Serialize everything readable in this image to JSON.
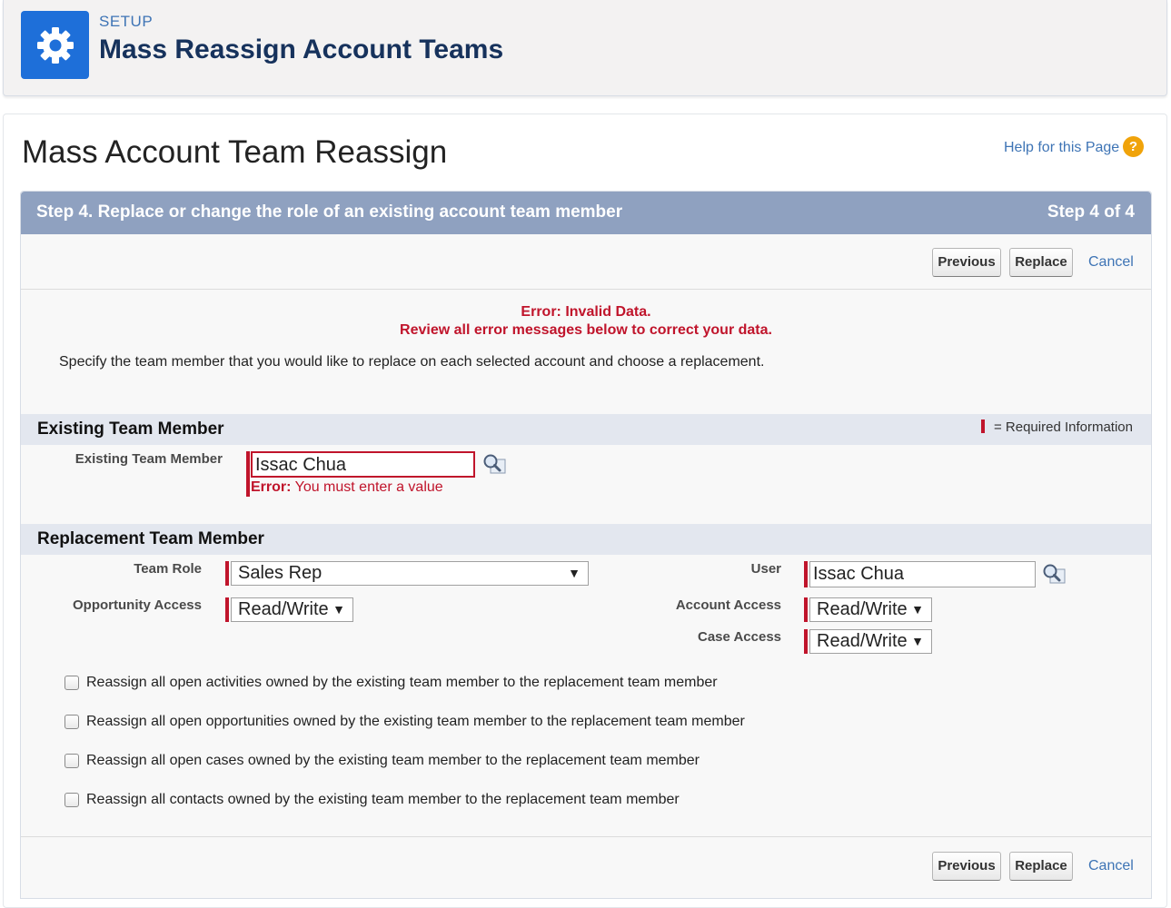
{
  "header": {
    "section_label": "SETUP",
    "title": "Mass Reassign Account Teams"
  },
  "page": {
    "title": "Mass Account Team Reassign",
    "help_link": "Help for this Page",
    "help_icon_glyph": "?"
  },
  "step": {
    "title": "Step 4. Replace or change the role of an existing account team member",
    "count": "Step 4 of 4"
  },
  "buttons": {
    "previous": "Previous",
    "replace": "Replace",
    "cancel": "Cancel"
  },
  "errors": {
    "title": "Error: Invalid Data.",
    "subtitle": "Review all error messages below to correct your data.",
    "field_error_prefix": "Error:",
    "field_error_text": " You must enter a value"
  },
  "instructions": "Specify the team member that you would like to replace on each selected account and choose a replacement.",
  "existing_section": {
    "title": "Existing Team Member",
    "required_legend": "= Required Information",
    "field_label": "Existing Team Member",
    "field_value": "Issac Chua"
  },
  "replacement_section": {
    "title": "Replacement Team Member",
    "team_role_label": "Team Role",
    "team_role_value": "Sales Rep",
    "opportunity_access_label": "Opportunity Access",
    "opportunity_access_value": "Read/Write",
    "user_label": "User",
    "user_value": "Issac Chua",
    "account_access_label": "Account Access",
    "account_access_value": "Read/Write",
    "case_access_label": "Case Access",
    "case_access_value": "Read/Write"
  },
  "checkboxes": [
    {
      "label": "Reassign all open activities owned by the existing team member to the replacement team member",
      "checked": false
    },
    {
      "label": "Reassign all open opportunities owned by the existing team member to the replacement team member",
      "checked": false
    },
    {
      "label": "Reassign all open cases owned by the existing team member to the replacement team member",
      "checked": false
    },
    {
      "label": "Reassign all contacts owned by the existing team member to the replacement team member",
      "checked": false
    }
  ],
  "colors": {
    "brand_blue": "#1e6fd9",
    "step_bar": "#8fa1c0",
    "error_red": "#c0142b",
    "link_blue": "#3e74b5"
  },
  "icons": [
    "gear-icon",
    "help-icon",
    "lookup-icon",
    "dropdown-caret-icon"
  ]
}
